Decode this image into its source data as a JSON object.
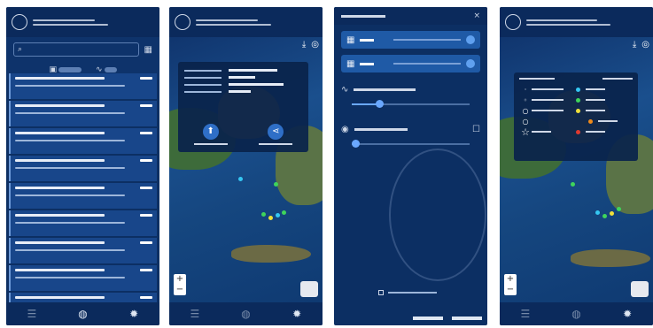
{
  "screens": [
    {
      "id": "list",
      "magnitude_filter_icon": "calendar-icon",
      "wave_icon": "waveform-icon"
    },
    {
      "id": "event-map",
      "info_icons": [
        "share-icon",
        "locate-icon"
      ]
    },
    {
      "id": "filter-dialog"
    },
    {
      "id": "legend-map"
    }
  ],
  "nav": {
    "icons": [
      "list-icon",
      "globe-icon",
      "settings-icon"
    ]
  },
  "map_colors": {
    "sea": "#1a4f8d",
    "land_green": "#3d6b3a",
    "land_brown": "#7a6d45"
  },
  "legend": {
    "magnitude_symbols": [
      "o",
      "o",
      "o",
      "o",
      "☆"
    ],
    "depth_colors": [
      "#35c7f2",
      "#3fd45b",
      "#f0e03a",
      "#f08a1a",
      "#e03a2f"
    ]
  },
  "event_dots": [
    "#3fd45b",
    "#35c7f2",
    "#3fd45b",
    "#f0e03a",
    "#3fd45b"
  ]
}
